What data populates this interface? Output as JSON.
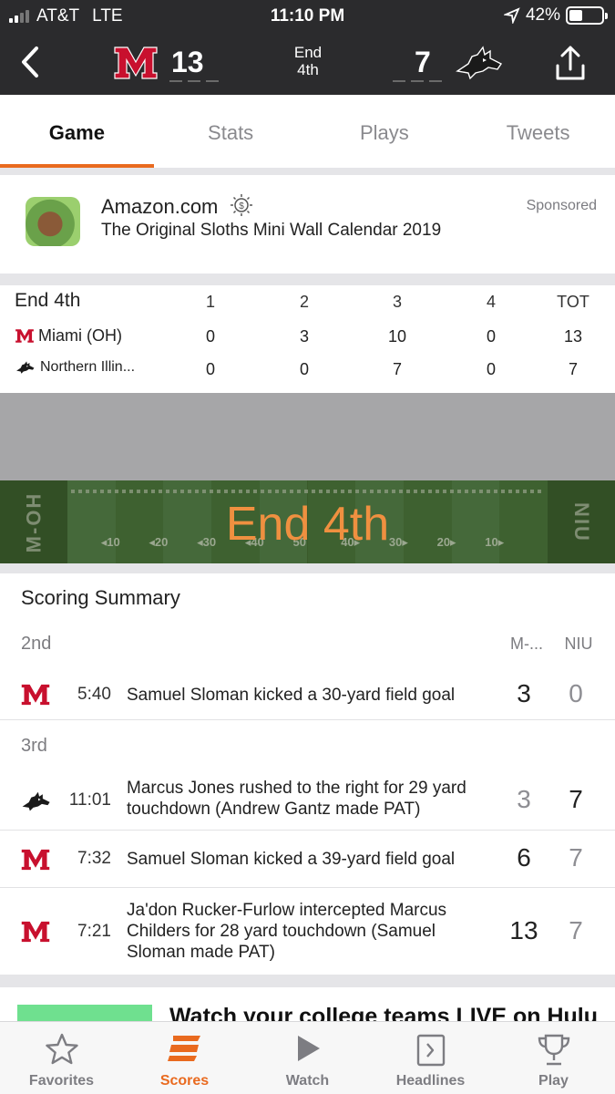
{
  "status_bar": {
    "carrier": "AT&T",
    "network": "LTE",
    "time": "11:10 PM",
    "battery": "42%",
    "battery_level": 0.42
  },
  "header": {
    "home_team": {
      "abbr": "M",
      "score": "13"
    },
    "period": [
      "End",
      "4th"
    ],
    "away_team": {
      "score": "7"
    }
  },
  "tabs": [
    {
      "label": "Game",
      "active": true
    },
    {
      "label": "Stats"
    },
    {
      "label": "Plays"
    },
    {
      "label": "Tweets"
    }
  ],
  "ad": {
    "advertiser": "Amazon.com",
    "product": "The Original Sloths Mini Wall Calendar 2019",
    "label": "Sponsored"
  },
  "linescore": {
    "period_label": "End 4th",
    "columns": [
      "1",
      "2",
      "3",
      "4",
      "TOT"
    ],
    "rows": [
      {
        "team": "Miami (OH)",
        "values": [
          "0",
          "3",
          "10",
          "0",
          "13"
        ]
      },
      {
        "team": "Northern Illin...",
        "values": [
          "0",
          "0",
          "7",
          "0",
          "7"
        ]
      }
    ]
  },
  "field": {
    "label": "End 4th",
    "left_endzone": "M-OH",
    "right_endzone": "NIU",
    "yard_markers": [
      "10",
      "20",
      "30",
      "40",
      "50",
      "40",
      "30",
      "20",
      "10"
    ]
  },
  "scoring_summary": {
    "title": "Scoring Summary",
    "col_home": "M-...",
    "col_away": "NIU",
    "quarters": [
      {
        "label": "2nd",
        "plays": [
          {
            "team": "M",
            "clock": "5:40",
            "desc": "Samuel Sloman kicked a 30-yard field goal",
            "home": "3",
            "away": "0"
          }
        ]
      },
      {
        "label": "3rd",
        "plays": [
          {
            "team": "NIU",
            "clock": "11:01",
            "desc": "Marcus Jones rushed to the right for 29 yard touchdown (Andrew Gantz made PAT)",
            "home": "3",
            "away": "7"
          },
          {
            "team": "M",
            "clock": "7:32",
            "desc": "Samuel Sloman kicked a 39-yard field goal",
            "home": "6",
            "away": "7"
          },
          {
            "team": "M",
            "clock": "7:21",
            "desc": "Ja'don Rucker-Furlow intercepted Marcus Childers for 28 yard touchdown (Samuel Sloman made PAT)",
            "home": "13",
            "away": "7"
          }
        ]
      }
    ]
  },
  "promo": {
    "text": "Watch your college teams LIVE on Hulu"
  },
  "bottom_nav": [
    {
      "label": "Favorites",
      "icon": "star-icon"
    },
    {
      "label": "Scores",
      "icon": "scores-icon",
      "active": true
    },
    {
      "label": "Watch",
      "icon": "play-icon"
    },
    {
      "label": "Headlines",
      "icon": "headlines-icon"
    },
    {
      "label": "Play",
      "icon": "trophy-icon"
    }
  ],
  "colors": {
    "accent": "#e96a1f",
    "miami_red": "#c8102e",
    "header_bg": "#2b2b2d",
    "field_green": "#3a5a2a"
  }
}
